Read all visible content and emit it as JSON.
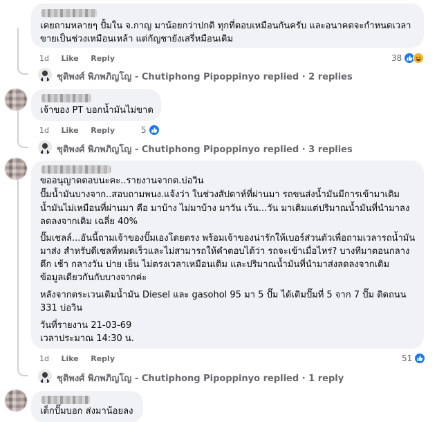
{
  "comments": [
    {
      "author_blurred": true,
      "lines": [
        "เคยถามหลายๆ ปั้มใน จ.กาญ มาน้อยกว่าปกติ ทุกที่ตอบเหมือนกันครับ และอนาคตจะกำหนดเวลา",
        "ขายเป็นช่วงเหมือนเหล้า แต่กัญชายังเสรี่หมือนเดิม"
      ],
      "time": "1d",
      "like_label": "Like",
      "reply_label": "Reply",
      "reaction_count": "38",
      "reactions": [
        "like-icon",
        "haha-icon"
      ],
      "replies_summary": "ชุติพงศ์ พิภพภิญโญ - Chutiphong Pipoppinyo replied · 2 replies"
    },
    {
      "author_blurred": true,
      "lines": [
        "เจ้าของ PT บอกน้ำมันไม่ขาด"
      ],
      "time": "1d",
      "like_label": "Like",
      "reply_label": "Reply",
      "reaction_count": "5",
      "reactions": [
        "like-icon"
      ],
      "replies_summary": "ชุติพงศ์ พิภพภิญโญ - Chutiphong Pipoppinyo replied · 3 replies"
    },
    {
      "author_blurred": true,
      "paragraphs": [
        [
          "ขออนุญาตตอบนะคะ..รายงานจากต.บ่อวิน",
          "ปั๊มน้ำมันบางจาก..สอบถามพนง.แจ้งว่า ในช่วงสัปดาห์ที่ผ่านมา รถขนส่งน้ำมันมีการเข้ามาเติม",
          "น้ำมันไม่เหมือนที่ผ่านมา คือ มาบ้าง ไม่มาบ้าง มาวัน เว้น...วัน มาเติมแต่ปริมาณน้ำมันที่นำมาลง",
          "ลดลงจากเดิม เฉลี่ย 40%"
        ],
        [
          "ปั๊มเชลล์...อันนี้ถามเจ้าของปั๊มเองโดยตรง พร้อมเจ้าของน่ารักให้เบอร์ส่วนตัวเพื่อถามเวลารถน้ำมัน",
          "มาส่ง สำหรับดีเซลที่หมดเร็วและไม่สามารถให้คำตอบได้ว่า รถจะเข้าเมื่อไหร่? บางทีมาตอนกลาง",
          "ดึก เช้า กลางวัน บ่าย เย็น ไม่ตรงเวลาเหมือนเดิม และปริมาณน้ำมันที่นำมาส่งลดลงจากเดิม",
          "ข้อมูลเดียวกันกับบางจากค่ะ"
        ],
        [
          "หลังจากตระเวนเติมน้ำมัน Diesel และ gasohol 95 มา 5 ปั๊ม ได้เติมปั๊มที่ 5 จาก 7 ปั๊ม ติดถนน",
          "331 บ่อวิน"
        ],
        [
          "วันที่รายงาน 21-03-69",
          "เวลาประมาณ 14:30 น."
        ]
      ],
      "time": "1d",
      "like_label": "Like",
      "reply_label": "Reply",
      "reaction_count": "51",
      "reactions": [
        "like-icon"
      ],
      "replies_summary": "ชุติพงศ์ พิภพภิญโญ - Chutiphong Pipoppinyo replied · 1 reply"
    },
    {
      "author_blurred": true,
      "lines": [
        "เด็กปั๊มบอก ส่งมาน้อยลง"
      ]
    }
  ],
  "colors": {
    "bubble": "#f0f2f5",
    "meta_text": "#65676b",
    "like_blue": "#1877f2",
    "haha_yellow": "#f7b125",
    "thread_line": "#ced0d4"
  }
}
